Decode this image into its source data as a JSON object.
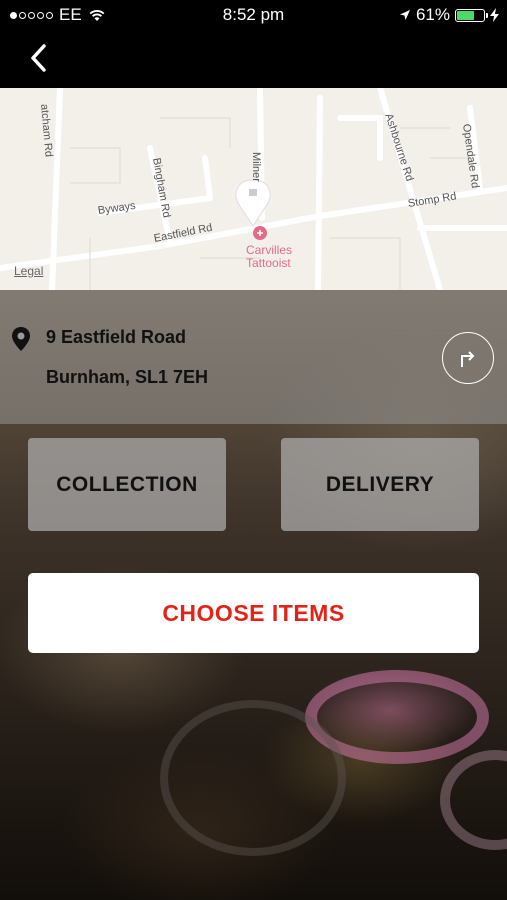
{
  "status_bar": {
    "carrier": "EE",
    "time": "8:52 pm",
    "battery_percent": "61%",
    "battery_level": 0.61,
    "battery_color": "#4cd964",
    "signal_bars_filled": 1,
    "signal_bars_total": 5,
    "icons": [
      "signal-dots-icon",
      "wifi-icon",
      "location-arrow-icon",
      "battery-icon",
      "charging-bolt-icon"
    ]
  },
  "nav": {
    "back_icon": "chevron-left-icon"
  },
  "map": {
    "streets": [
      "atcham Rd",
      "Bingham Rd",
      "Milner",
      "Ashbourne Rd",
      "Opendale Rd",
      "Byways",
      "Eastfield Rd",
      "Stomp Rd"
    ],
    "poi": {
      "name_line1": "Carvilles",
      "name_line2": "Tattooist",
      "icon": "poi-pin-icon"
    },
    "legal": "Legal",
    "marker_icon": "map-marker-icon"
  },
  "address": {
    "line1": "9 Eastfield Road",
    "line2": "Burnham, SL1 7EH",
    "pin_icon": "location-pin-icon",
    "directions_icon": "directions-turn-icon"
  },
  "options": {
    "collection_label": "COLLECTION",
    "delivery_label": "DELIVERY"
  },
  "cta": {
    "label": "CHOOSE ITEMS",
    "color": "#e2231a"
  }
}
